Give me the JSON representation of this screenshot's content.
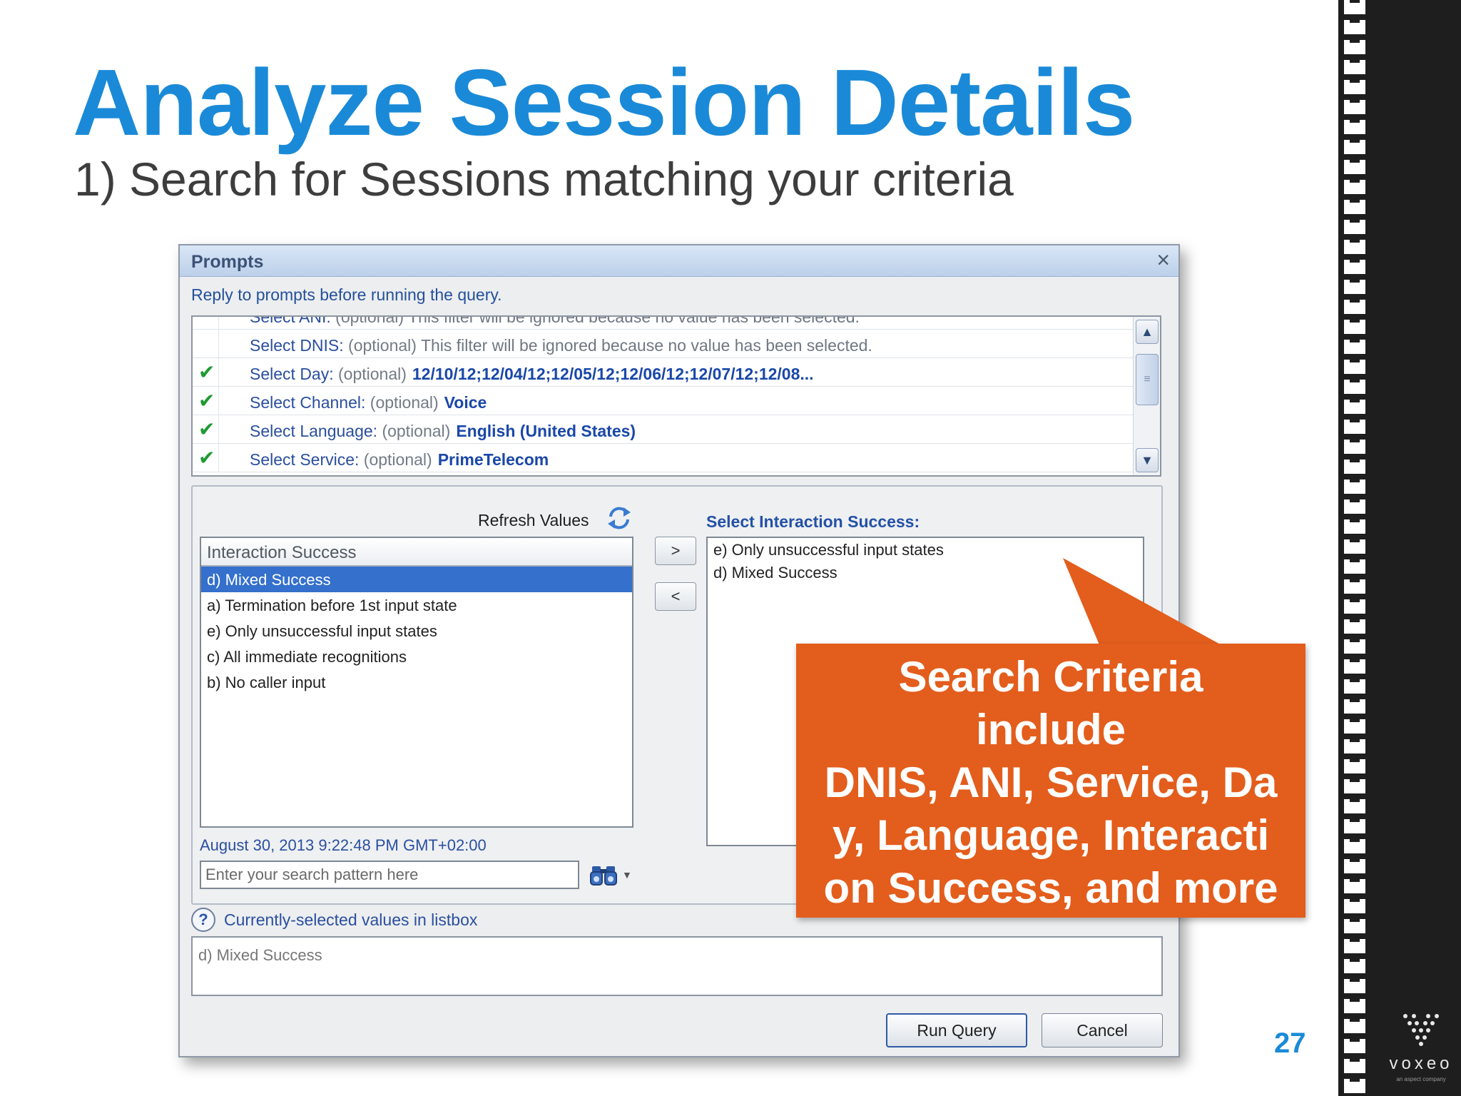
{
  "slide": {
    "title": "Analyze Session Details",
    "subtitle": "1) Search for Sessions matching your criteria",
    "page_number": "27",
    "logo": {
      "name": "voxeo",
      "tagline": "an aspect company"
    }
  },
  "dialog": {
    "title": "Prompts",
    "close_icon": "×",
    "instruction": "Reply to prompts before running the query.",
    "prompts": [
      {
        "checked": false,
        "label": "Select ANI:",
        "optional": "(optional)",
        "value": "",
        "note": "This filter will be ignored because no value has been selected."
      },
      {
        "checked": false,
        "label": "Select DNIS:",
        "optional": "(optional)",
        "value": "",
        "note": "This filter will be ignored because no value has been selected."
      },
      {
        "checked": true,
        "check_mark": "✔",
        "label": "Select Day:",
        "optional": "(optional)",
        "value": "12/10/12;12/04/12;12/05/12;12/06/12;12/07/12;12/08...",
        "note": ""
      },
      {
        "checked": true,
        "check_mark": "✔",
        "label": "Select Channel:",
        "optional": "(optional)",
        "value": "Voice",
        "note": ""
      },
      {
        "checked": true,
        "check_mark": "✔",
        "label": "Select Language:",
        "optional": "(optional)",
        "value": "English (United States)",
        "note": ""
      },
      {
        "checked": true,
        "check_mark": "✔",
        "label": "Select Service:",
        "optional": "(optional)",
        "value": "PrimeTelecom",
        "note": ""
      }
    ],
    "scroll_up": "▲",
    "scroll_down": "▼",
    "scroll_grip": "≡",
    "refresh_label": "Refresh Values",
    "listbox": {
      "header": "Interaction Success",
      "items": [
        {
          "label": "d) Mixed Success",
          "selected": true
        },
        {
          "label": "a) Termination before 1st input state",
          "selected": false
        },
        {
          "label": "e) Only unsuccessful input states",
          "selected": false
        },
        {
          "label": "c) All immediate recognitions",
          "selected": false
        },
        {
          "label": "b) No caller input",
          "selected": false
        }
      ]
    },
    "add_button": ">",
    "remove_button": "<",
    "select_label": "Select Interaction Success:",
    "selected_values": [
      "e) Only unsuccessful input states",
      "d) Mixed Success"
    ],
    "timestamp": "August 30, 2013 9:22:48 PM GMT+02:00",
    "search_placeholder": "Enter your search pattern here",
    "search_dropdown": "▼",
    "help_icon": "?",
    "help_text": "Currently-selected values in listbox",
    "current_value": "d) Mixed Success",
    "run_button": "Run Query",
    "cancel_button": "Cancel"
  },
  "callout": {
    "lines": [
      "Search Criteria",
      "include",
      "DNIS, ANI, Service, Da",
      "y, Language, Interacti",
      "on Success, and more"
    ]
  },
  "colors": {
    "accent": "#1a8ad8",
    "callout": "#e35d1c",
    "selection": "#3470cc",
    "check": "#1f9a32"
  }
}
